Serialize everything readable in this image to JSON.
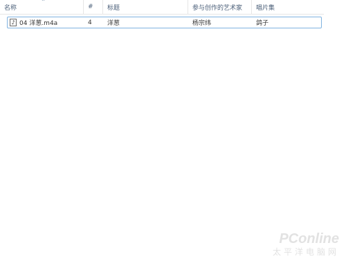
{
  "header": {
    "columns": [
      {
        "label": "名称"
      },
      {
        "label": "#"
      },
      {
        "label": "标题"
      },
      {
        "label": "参与创作的艺术家"
      },
      {
        "label": "唱片集"
      }
    ],
    "sort_indicator": "^"
  },
  "files": [
    {
      "name": "04 洋葱.m4a",
      "track": "4",
      "title": "洋葱",
      "artist": "杨宗纬",
      "album": "鸽子",
      "icon": "music-note-icon"
    }
  ],
  "watermark": {
    "main": "PConline",
    "sub": "太平洋电脑网"
  }
}
